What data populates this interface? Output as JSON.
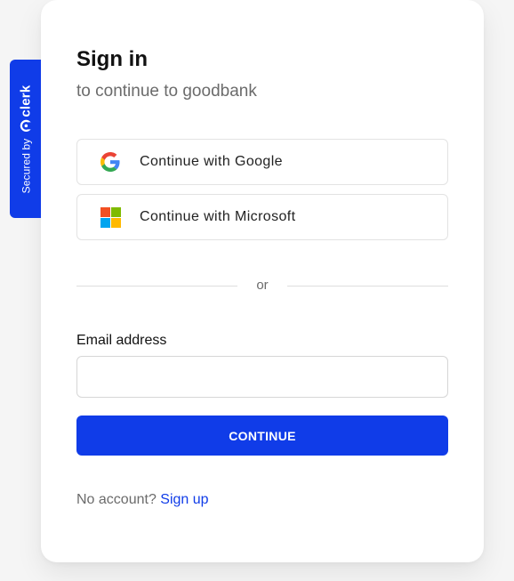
{
  "badge": {
    "secured_text": "Secured by",
    "brand_text": "clerk"
  },
  "header": {
    "title": "Sign in",
    "subtitle": "to continue to goodbank"
  },
  "social": {
    "google_label": "Continue with Google",
    "microsoft_label": "Continue with Microsoft"
  },
  "divider": {
    "text": "or"
  },
  "form": {
    "email_label": "Email address",
    "email_value": "",
    "email_placeholder": "",
    "continue_label": "CONTINUE"
  },
  "footer": {
    "prompt": "No account?",
    "link": "Sign up"
  },
  "colors": {
    "accent": "#103ce8",
    "text_muted": "#6b6b6b",
    "border": "#e3e3e3"
  }
}
